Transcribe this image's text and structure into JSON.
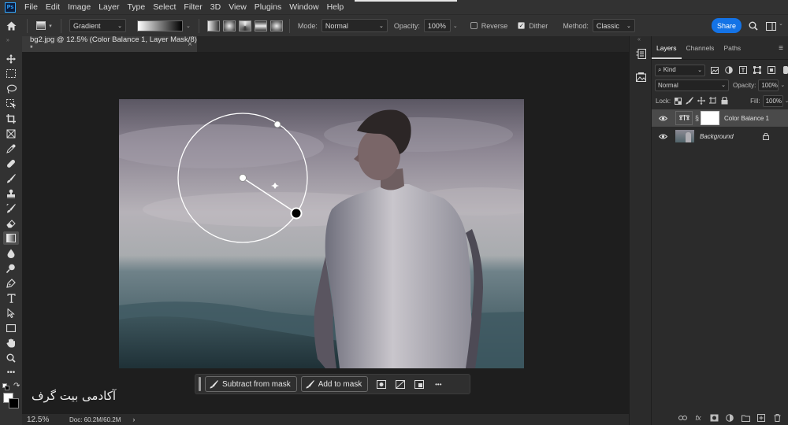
{
  "app": {
    "logo_text": "Ps",
    "menu": [
      "File",
      "Edit",
      "Image",
      "Layer",
      "Type",
      "Select",
      "Filter",
      "3D",
      "View",
      "Plugins",
      "Window",
      "Help"
    ]
  },
  "options": {
    "gradient_type": "Gradient",
    "mode_label": "Mode:",
    "mode_value": "Normal",
    "opacity_label": "Opacity:",
    "opacity_value": "100%",
    "reverse_label": "Reverse",
    "reverse_checked": false,
    "dither_label": "Dither",
    "dither_checked": true,
    "method_label": "Method:",
    "method_value": "Classic",
    "share_label": "Share"
  },
  "document": {
    "tab_title": "bg2.jpg @ 12.5% (Color Balance 1, Layer Mask/8) *",
    "close_glyph": "×"
  },
  "taskbar": {
    "subtract_label": "Subtract from mask",
    "add_label": "Add to mask",
    "more_glyph": "•••"
  },
  "watermark": "آکادمی بیت گرف",
  "status": {
    "zoom": "12.5%",
    "doc_size": "Doc: 60.2M/60.2M",
    "arrow": "›"
  },
  "layers_panel": {
    "tabs": [
      "Layers",
      "Channels",
      "Paths"
    ],
    "filter_kind": "Kind",
    "blend_mode": "Normal",
    "opacity_label": "Opacity:",
    "opacity_value": "100%",
    "lock_label": "Lock:",
    "fill_label": "Fill:",
    "fill_value": "100%",
    "layers": [
      {
        "name": "Color Balance 1",
        "selected": true,
        "visible": true
      },
      {
        "name": "Background",
        "selected": false,
        "visible": true,
        "locked": true
      }
    ],
    "footer_fx": "fx"
  },
  "colors": {
    "accent": "#1473e6",
    "foreground_color": "#ffffff",
    "background_color": "#000000"
  }
}
